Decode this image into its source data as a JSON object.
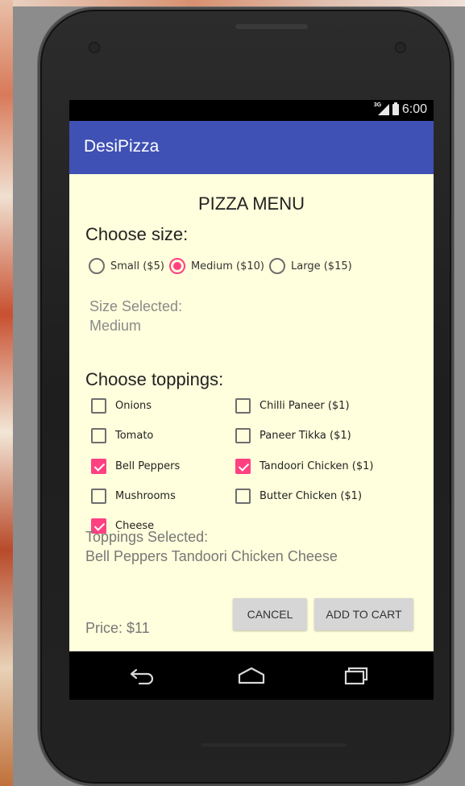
{
  "status_bar": {
    "time": "6:00",
    "network": "3G"
  },
  "app_bar": {
    "title": "DesiPizza"
  },
  "menu_title": "PIZZA MENU",
  "size_section": {
    "heading": "Choose size:",
    "options": [
      {
        "label": "Small ($5)",
        "checked": false
      },
      {
        "label": "Medium ($10)",
        "checked": true
      },
      {
        "label": "Large ($15)",
        "checked": false
      }
    ],
    "selected_label": "Size Selected:",
    "selected_value": "Medium"
  },
  "toppings_section": {
    "heading": "Choose toppings:",
    "items": [
      {
        "label": "Onions",
        "checked": false
      },
      {
        "label": "Chilli Paneer ($1)",
        "checked": false
      },
      {
        "label": "Tomato",
        "checked": false
      },
      {
        "label": "Paneer Tikka ($1)",
        "checked": false
      },
      {
        "label": "Bell Peppers",
        "checked": true
      },
      {
        "label": "Tandoori Chicken ($1)",
        "checked": true
      },
      {
        "label": "Mushrooms",
        "checked": false
      },
      {
        "label": "Butter Chicken ($1)",
        "checked": false
      },
      {
        "label": "Cheese",
        "checked": true
      }
    ],
    "selected_label": "Toppings Selected:",
    "selected_value": "Bell Peppers Tandoori Chicken Cheese"
  },
  "price": "Price: $11",
  "buttons": {
    "cancel": "CANCEL",
    "add_to_cart": "ADD TO CART"
  },
  "colors": {
    "primary": "#3f51b5",
    "accent": "#ff4081",
    "content_bg": "#ffffdd"
  },
  "icons": {
    "back": "back-arrow-icon",
    "home": "home-icon",
    "recents": "recents-icon"
  }
}
